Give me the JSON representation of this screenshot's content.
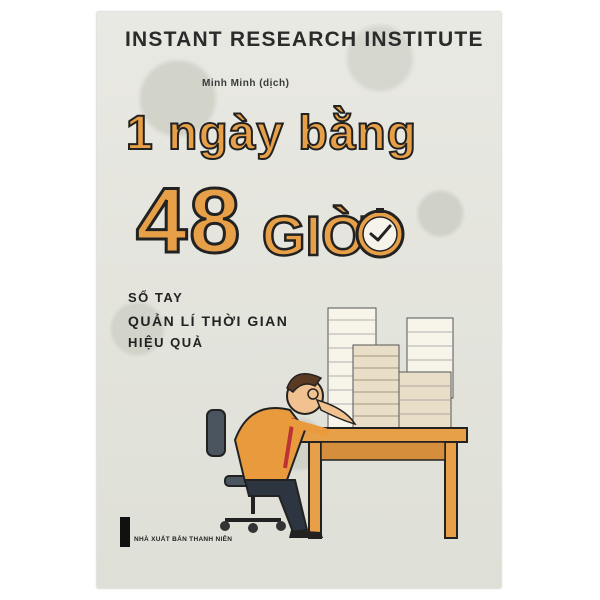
{
  "cover": {
    "publisher_line": "INSTANT RESEARCH INSTITUTE",
    "translator": "Minh Minh (dịch)",
    "title_part1": "1 ngày bằng",
    "title_part2": "48",
    "title_part3": "GIỜ",
    "subtitle_line1": "SỔ TAY",
    "subtitle_line2": "QUẢN LÍ THỜI GIAN",
    "subtitle_line3": "HIỆU QUẢ",
    "publisher_name": "NHÀ XUẤT BẢN THANH NIÊN",
    "accent_color": "#e8a048",
    "background_color": "#e7e7e1",
    "illustration": "tired-man-at-desk-with-paper-stacks"
  }
}
